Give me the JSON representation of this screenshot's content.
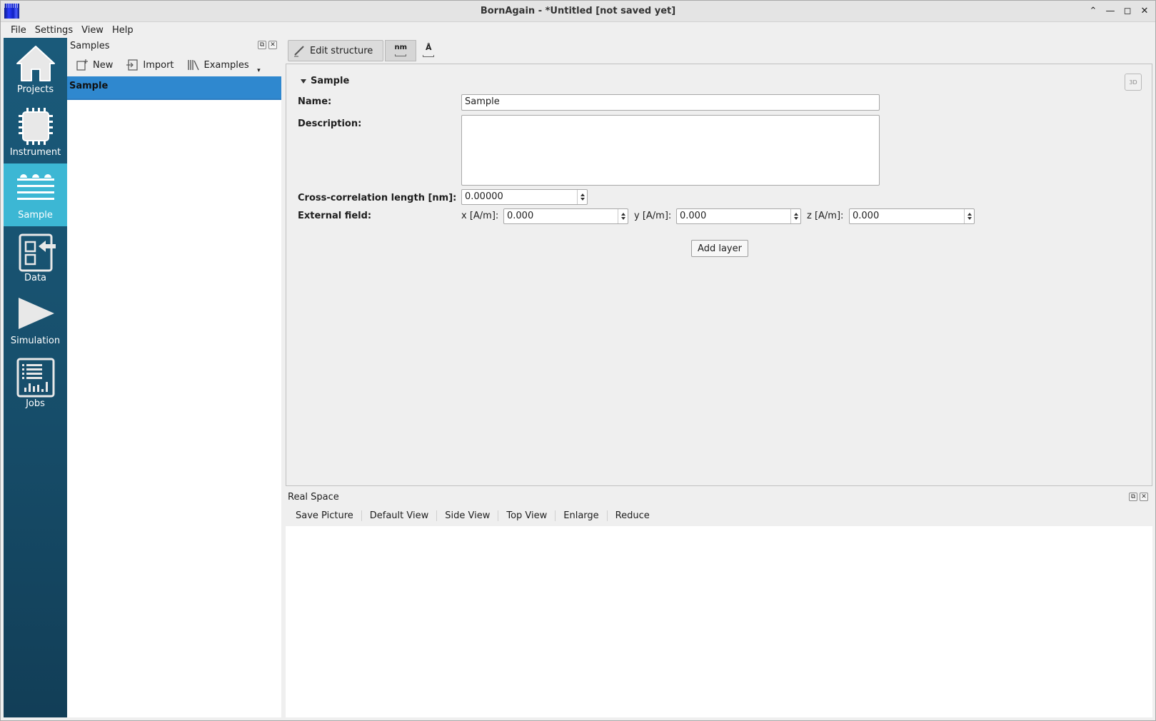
{
  "window": {
    "title": "BornAgain - *Untitled [not saved yet]"
  },
  "menu": {
    "items": [
      "File",
      "Settings",
      "View",
      "Help"
    ]
  },
  "nav": {
    "items": [
      {
        "label": "Projects",
        "icon": "house-icon"
      },
      {
        "label": "Instrument",
        "icon": "chip-icon"
      },
      {
        "label": "Sample",
        "icon": "layers-icon",
        "active": true
      },
      {
        "label": "Data",
        "icon": "import-data-icon"
      },
      {
        "label": "Simulation",
        "icon": "play-icon"
      },
      {
        "label": "Jobs",
        "icon": "jobs-icon"
      }
    ]
  },
  "samples_panel": {
    "title": "Samples",
    "toolbar": {
      "new": "New",
      "import": "Import",
      "examples": "Examples"
    },
    "items": [
      "Sample"
    ]
  },
  "edit_toolbar": {
    "edit_structure": "Edit structure",
    "unit_nm": "nm",
    "unit_angstrom": "Å"
  },
  "editor": {
    "section_title": "Sample",
    "name_label": "Name:",
    "name_value": "Sample",
    "description_label": "Description:",
    "description_value": "",
    "cross_corr_label": "Cross-correlation length [nm]:",
    "cross_corr_value": "0.00000",
    "external_field_label": "External field:",
    "x_label": "x [A/m]:",
    "x_value": "0.000",
    "y_label": "y [A/m]:",
    "y_value": "0.000",
    "z_label": "z [A/m]:",
    "z_value": "0.000",
    "add_layer": "Add layer"
  },
  "real_space": {
    "title": "Real Space",
    "toolbar": [
      "Save Picture",
      "Default View",
      "Side View",
      "Top View",
      "Enlarge",
      "Reduce"
    ]
  }
}
